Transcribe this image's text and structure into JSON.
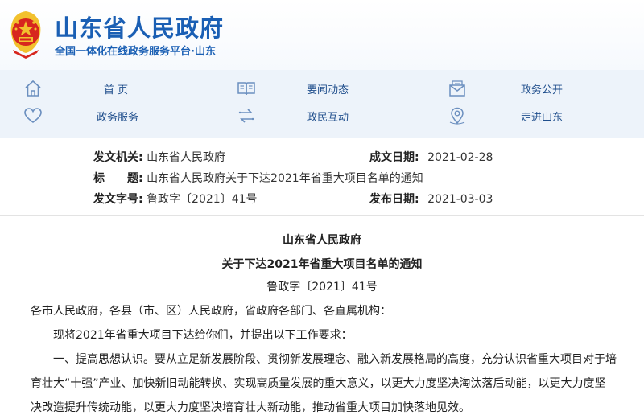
{
  "header": {
    "title": "山东省人民政府",
    "subtitle": "全国一体化在线政务服务平台·山东",
    "emblem_icon": "national-emblem-icon"
  },
  "nav": {
    "items": [
      {
        "label": "首 页",
        "icon": "home-icon"
      },
      {
        "label": "要闻动态",
        "icon": "book-icon"
      },
      {
        "label": "政务公开",
        "icon": "mail-icon"
      },
      {
        "label": "政务服务",
        "icon": "heart-icon"
      },
      {
        "label": "政民互动",
        "icon": "exchange-icon"
      },
      {
        "label": "走进山东",
        "icon": "location-icon"
      }
    ]
  },
  "meta": {
    "issuer_key": "发文机关:",
    "issuer_val": "山东省人民政府",
    "date_key": "成文日期:",
    "date_val": "2021-02-28",
    "title_key": "标　　题:",
    "title_val": "山东省人民政府关于下达2021年省重大项目名单的通知",
    "docno_key": "发文字号:",
    "docno_val": "鲁政字〔2021〕41号",
    "pubdate_key": "发布日期:",
    "pubdate_val": "2021-03-03"
  },
  "document": {
    "org": "山东省人民政府",
    "title": "关于下达2021年省重大项目名单的通知",
    "docno": "鲁政字〔2021〕41号",
    "addressee": "各市人民政府，各县（市、区）人民政府，省政府各部门、各直属机构：",
    "p1": "现将2021年省重大项目下达给你们，并提出以下工作要求：",
    "p2_line1": "一、提高思想认识。要从立足新发展阶段、贯彻新发展理念、融入新发展格局的高度，充分认识省重大项目对于培",
    "p2_line2": "育壮大“十强”产业、加快新旧动能转换、实现高质量发展的重大意义，以更大力度坚决淘汰落后动能，以更大力度坚",
    "p2_line3": "决改造提升传统动能，以更大力度坚决培育壮大新动能，推动省重大项目加快落地见效。"
  },
  "colors": {
    "brand_blue": "#1a5fb4",
    "nav_bg": "#edf3fa",
    "emblem_red": "#d7261e",
    "emblem_gold": "#f2c12e"
  }
}
